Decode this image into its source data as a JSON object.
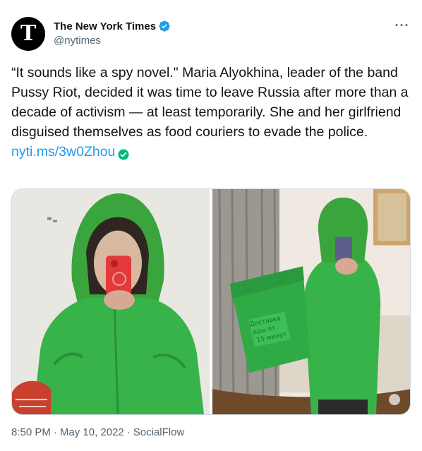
{
  "author": {
    "display_name": "The New York Times",
    "handle": "@nytimes",
    "avatar_glyph": "T",
    "verified": true
  },
  "tweet": {
    "text": "“It sounds like a spy novel.\" Maria Alyokhina, leader of the band Pussy Riot, decided it was time to leave Russia after more than a decade of activism — at least temporarily. She and her girlfriend disguised themselves as food couriers to evade the police.",
    "link_text": "nyti.ms/3w0Zhou",
    "link_badge_icon": "check-circle-icon"
  },
  "media": {
    "backpack_text": [
      "Доставка",
      "еды от",
      "15 минут"
    ]
  },
  "meta": {
    "time": "8:50 PM",
    "separator": "·",
    "date": "May 10, 2022",
    "source": "SocialFlow"
  },
  "colors": {
    "link": "#1d9bf0",
    "verified": "#1d9bf0",
    "secondary_text": "#536471",
    "jacket_green": "#37b34a"
  }
}
